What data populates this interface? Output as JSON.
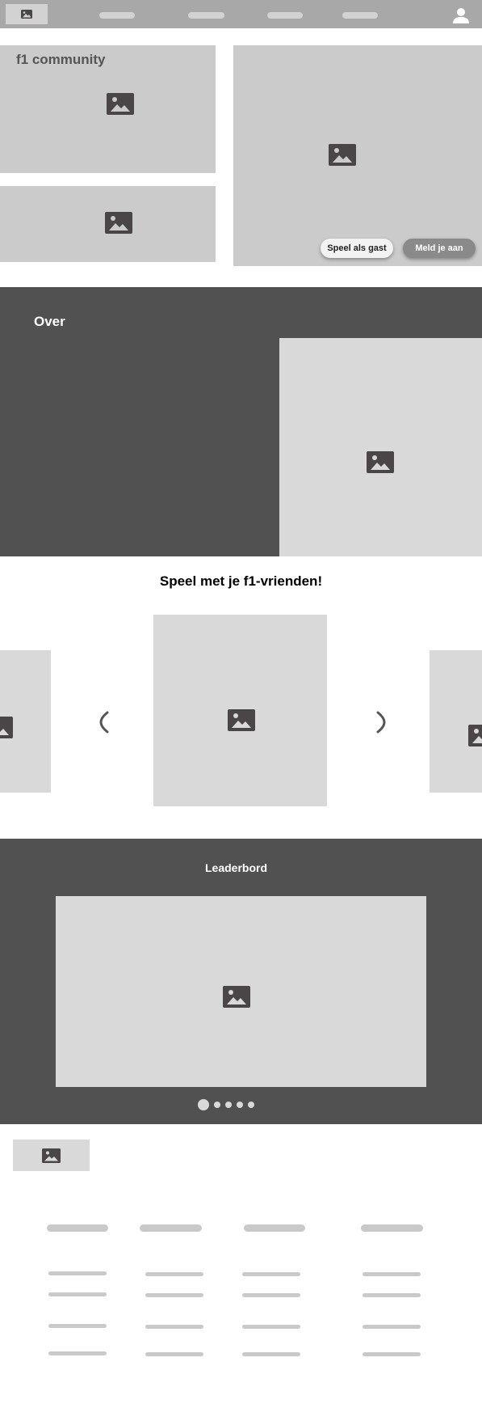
{
  "header": {
    "nav_items": [
      "",
      "",
      "",
      ""
    ],
    "logo_icon": "image-placeholder-icon",
    "account_icon": "user-icon"
  },
  "hero": {
    "title": "f1 community",
    "guest_button": "Speel als gast",
    "signin_button": "Meld je aan"
  },
  "about": {
    "title": "Over"
  },
  "friends": {
    "title": "Speel met je f1-vrienden!",
    "prev_icon": "chevron-left-icon",
    "next_icon": "chevron-right-icon"
  },
  "leaderboard": {
    "title": "Leaderbord",
    "slide_count": 5,
    "active_slide": 1
  },
  "footer": {
    "columns": 4
  },
  "colors": {
    "nav_bg": "#a8a8a8",
    "dark_bg": "#515151",
    "placeholder": "#cbcbcb",
    "icon": "#4a4546"
  }
}
